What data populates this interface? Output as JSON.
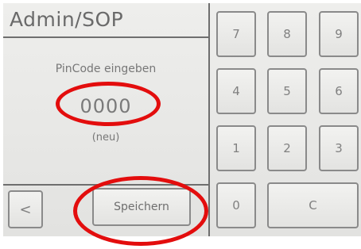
{
  "header": {
    "title": "Admin/SOP"
  },
  "pin": {
    "label": "PinCode eingeben",
    "value": "0000",
    "note": "(neu)"
  },
  "actions": {
    "back_label": "<",
    "save_label": "Speichern"
  },
  "keypad": {
    "keys": [
      "7",
      "8",
      "9",
      "4",
      "5",
      "6",
      "1",
      "2",
      "3",
      "0",
      "C"
    ]
  },
  "annotations": {
    "highlight_color": "#e30d0d"
  }
}
